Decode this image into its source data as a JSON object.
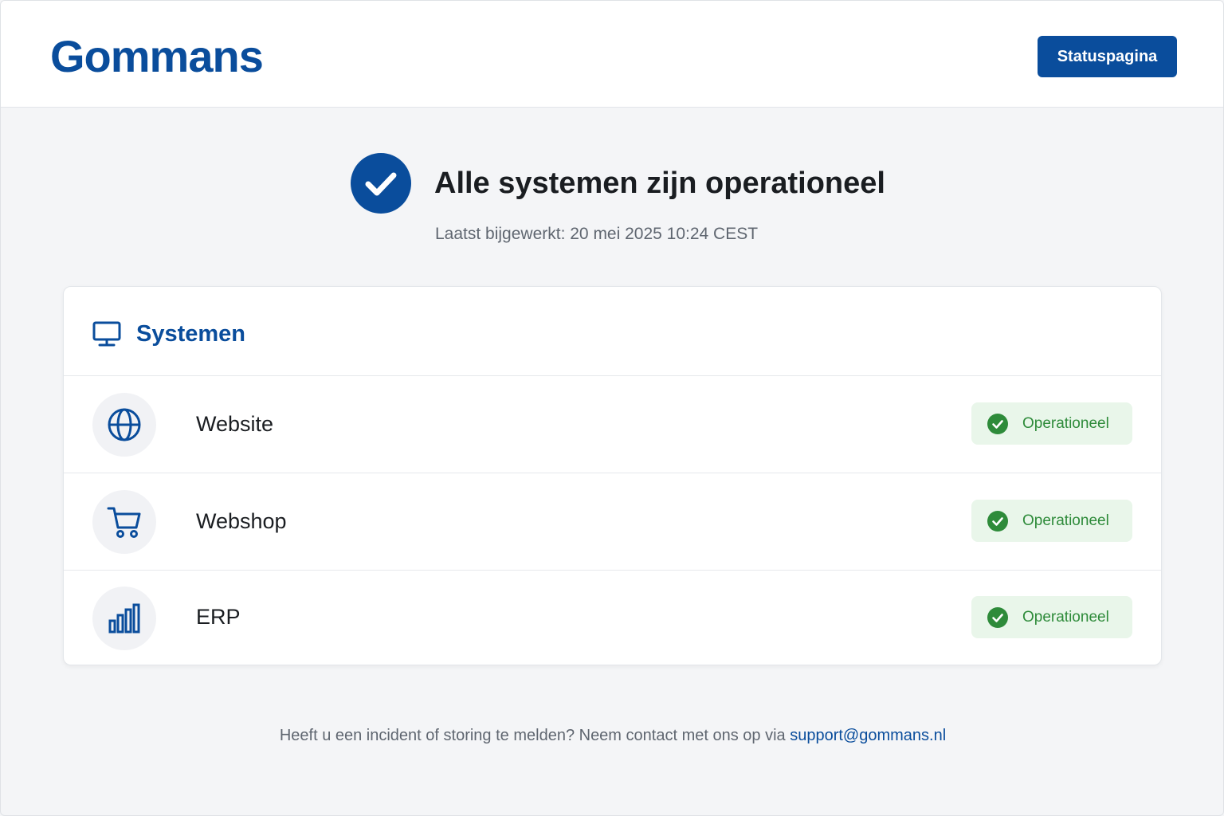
{
  "header": {
    "logo": "Gommans",
    "status_button": "Statuspagina"
  },
  "hero": {
    "title": "Alle systemen zijn operationeel",
    "updated": "Laatst bijgewerkt: 20 mei 2025 10:24 CEST"
  },
  "systems": {
    "title": "Systemen",
    "items": [
      {
        "name": "Website",
        "status": "Operationeel",
        "icon": "globe-icon"
      },
      {
        "name": "Webshop",
        "status": "Operationeel",
        "icon": "shopping-cart-icon"
      },
      {
        "name": "ERP",
        "status": "Operationeel",
        "icon": "bar-chart-icon"
      }
    ]
  },
  "footer": {
    "text": "Heeft u een incident of storing te melden? Neem contact met ons op via ",
    "email": "support@gommans.nl"
  },
  "colors": {
    "brand": "#0a4d9c",
    "success": "#2e8b3a",
    "success_bg": "#e9f6ea"
  }
}
